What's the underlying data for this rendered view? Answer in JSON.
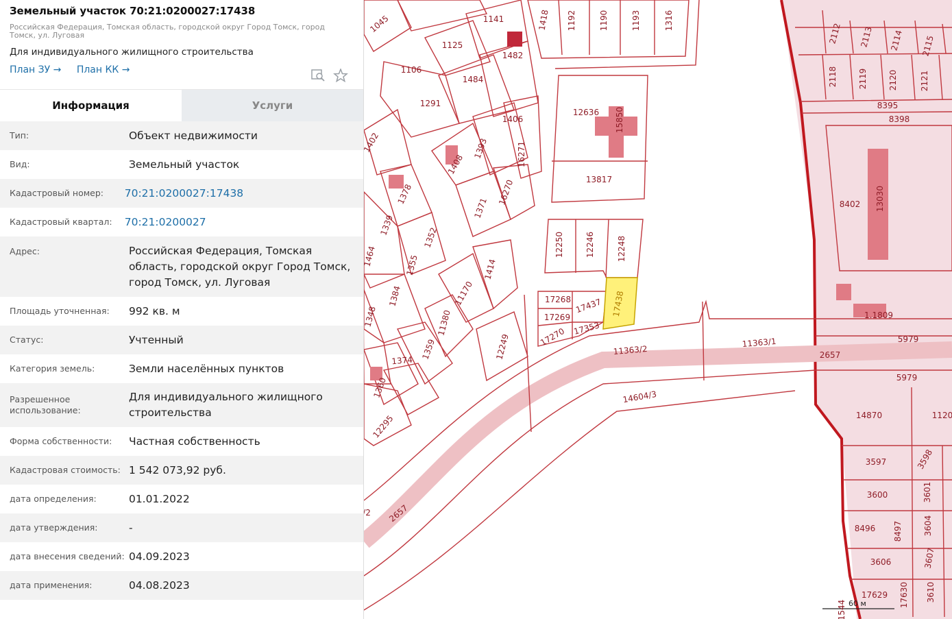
{
  "header": {
    "title": "Земельный участок 70:21:0200027:17438",
    "address": "Российская Федерация, Томская область, городской округ Город Томск, город Томск, ул. Луговая",
    "permitted_use": "Для индивидуального жилищного строительства",
    "plan_zu": "План ЗУ →",
    "plan_kk": "План КК →",
    "search_icon": "search-map-icon",
    "star_icon": "star-icon"
  },
  "tabs": {
    "info": "Информация",
    "services": "Услуги"
  },
  "rows": [
    {
      "label": "Тип:",
      "value": "Объект недвижимости"
    },
    {
      "label": "Вид:",
      "value": "Земельный участок"
    },
    {
      "label": "Кадастровый номер:",
      "value": "70:21:0200027:17438"
    },
    {
      "label": "Кадастровый квартал:",
      "value": "70:21:0200027"
    },
    {
      "label": "Адрес:",
      "value": "Российская Федерация, Томская область, городской округ Город Томск, город Томск, ул. Луговая"
    },
    {
      "label": "Площадь уточненная:",
      "value": "992 кв. м"
    },
    {
      "label": "Статус:",
      "value": "Учтенный"
    },
    {
      "label": "Категория земель:",
      "value": "Земли населённых пунктов"
    },
    {
      "label": "Разрешенное использование:",
      "value": "Для индивидуального жилищного строительства"
    },
    {
      "label": "Форма собственности:",
      "value": "Частная собственность"
    },
    {
      "label": "Кадастровая стоимость:",
      "value": "1 542 073,92 руб."
    },
    {
      "label": "дата определения:",
      "value": "01.01.2022"
    },
    {
      "label": "дата утверждения:",
      "value": "-"
    },
    {
      "label": "дата внесения сведений:",
      "value": "04.09.2023"
    },
    {
      "label": "дата применения:",
      "value": "04.08.2023"
    }
  ],
  "map": {
    "selected_parcel": "17438",
    "scale_label": "60 м",
    "labels": [
      "1045",
      "1141",
      "1418",
      "1192",
      "1190",
      "1193",
      "1316",
      "2112",
      "2113",
      "2114",
      "2115",
      "1125",
      "1482",
      "1106",
      "1484",
      "2118",
      "2119",
      "2120",
      "2121",
      "8395",
      "8398",
      "12636",
      "15850",
      "1291",
      "1406",
      "1402",
      "1393",
      "16271",
      "1408",
      "13817",
      "1378",
      "16270",
      "13030",
      "8402",
      "1371",
      "1339",
      "1352",
      "12250",
      "12246",
      "12248",
      "1464",
      "1355",
      "1414",
      "1384",
      "11170",
      "17268",
      "17437",
      "1348",
      "17269",
      "1.1809",
      "11380",
      "17270",
      "17353",
      "11363/1",
      "5979",
      "1359",
      "11363/2",
      "2657",
      "1374",
      "12249",
      "1360",
      "5979",
      "14604/3",
      "14870",
      "1120",
      "12295",
      "3597",
      "3598",
      "3600",
      "3601",
      "2657",
      "8496",
      "8497",
      "3604",
      "3606",
      "3607",
      "17629",
      "17630",
      "3610",
      "/2",
      "1544"
    ]
  },
  "colors": {
    "link": "#1e6fa8",
    "parcel_outline": "#c0383f",
    "parcel_fill": "#f4dde2",
    "building": "#e07b85",
    "selected": "#fff17a"
  }
}
